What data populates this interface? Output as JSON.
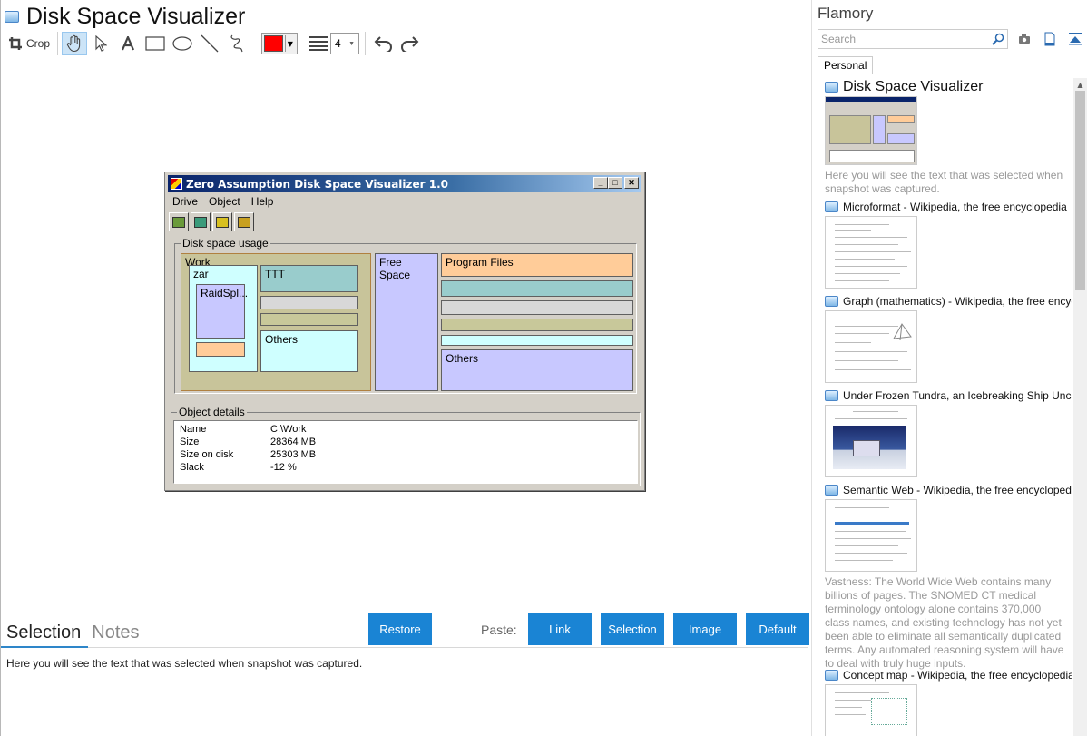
{
  "window": {
    "title": "Disk Space Visualizer"
  },
  "toolbar": {
    "crop_label": "Crop",
    "line_width_value": "4",
    "active_color": "#ff0000",
    "tools": [
      "crop-icon",
      "hand-icon",
      "pointer-icon",
      "text-icon",
      "rectangle-icon",
      "ellipse-icon",
      "line-icon",
      "freehand-icon",
      "line-width-icon",
      "undo-icon",
      "redo-icon"
    ]
  },
  "snapshot": {
    "title": "Zero Assumption Disk Space Visualizer 1.0",
    "menu": [
      "Drive",
      "Object",
      "Help"
    ],
    "group_usage": "Disk space usage",
    "blocks": {
      "work": "Work",
      "zar": "zar",
      "raidspl": "RaidSpl...",
      "ttt": "TTT",
      "others_left": "Others",
      "free_space": "Free Space",
      "program_files": "Program Files",
      "others_right": "Others"
    },
    "group_details": "Object details",
    "details": [
      {
        "key": "Name",
        "value": "C:\\Work"
      },
      {
        "key": "Size",
        "value": "28364 MB"
      },
      {
        "key": "Size on disk",
        "value": "25303 MB"
      },
      {
        "key": "Slack",
        "value": "-12 %"
      }
    ]
  },
  "bottom": {
    "tabs": [
      "Selection",
      "Notes"
    ],
    "restore": "Restore",
    "paste_label": "Paste:",
    "paste_buttons": [
      "Link",
      "Selection",
      "Image",
      "Default"
    ],
    "selection_text": "Here you will see the text that was selected when snapshot was captured."
  },
  "sidebar": {
    "brand": "Flamory",
    "search_placeholder": "Search",
    "tab": "Personal",
    "items": [
      {
        "title": "Disk Space Visualizer",
        "desc": "Here you will see the text that was selected when snapshot was captured."
      },
      {
        "title": "Microformat - Wikipedia, the free encyclopedia"
      },
      {
        "title": "Graph (mathematics) - Wikipedia, the free encyclopedia"
      },
      {
        "title": "Under Frozen Tundra, an Icebreaking Ship Uncovers"
      },
      {
        "title": "Semantic Web - Wikipedia, the free encyclopedia",
        "desc": "Vastness: The World Wide Web contains many billions of pages. The SNOMED CT medical terminology ontology alone contains 370,000 class names, and existing technology has not yet been able to eliminate all semantically duplicated terms. Any automated reasoning system will have to deal with truly huge inputs."
      },
      {
        "title": "Concept map - Wikipedia, the free encyclopedia"
      }
    ]
  },
  "colors": {
    "accent": "#1a84d4",
    "tab_underline": "#2e86c9"
  }
}
